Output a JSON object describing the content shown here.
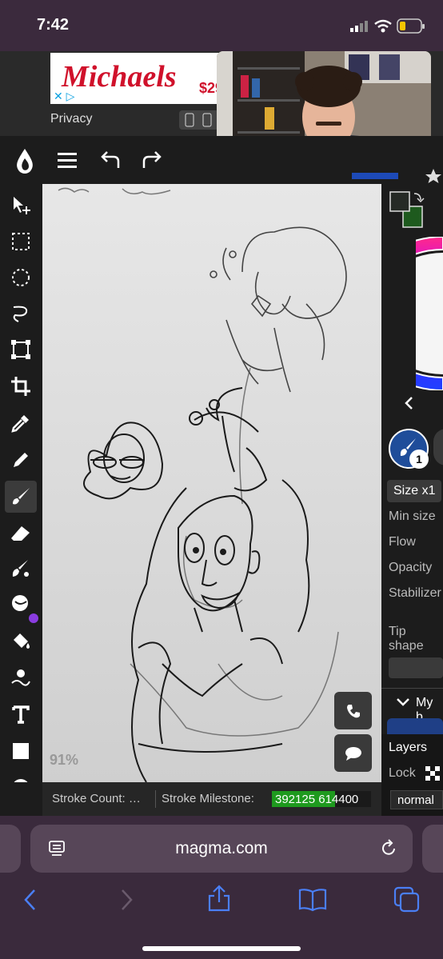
{
  "status": {
    "time": "7:42"
  },
  "ad": {
    "brand": "Michaels",
    "price": "$29",
    "privacy": "Privacy"
  },
  "canvas": {
    "zoom": "91%"
  },
  "right_panel": {
    "size_button": "Size x1",
    "brush_badge": "1",
    "props": [
      "Min size",
      "Flow",
      "Opacity",
      "Stabilizer",
      "Tip shape"
    ],
    "brushes_header": "My b",
    "layers_label": "Layers",
    "lock_label": "Lock",
    "blend_mode": "normal"
  },
  "bottom": {
    "stroke_count": "Stroke Count: …",
    "stroke_milestone_label": "Stroke Milestone:",
    "stroke_milestone_value": "392125 614400",
    "stroke_milestone_progress": 0.638
  },
  "browser": {
    "url": "magma.com"
  },
  "colors": {
    "primary": "#262a26",
    "secondary": "#1e5a1e",
    "accent_progress": "#1e9a1e"
  }
}
